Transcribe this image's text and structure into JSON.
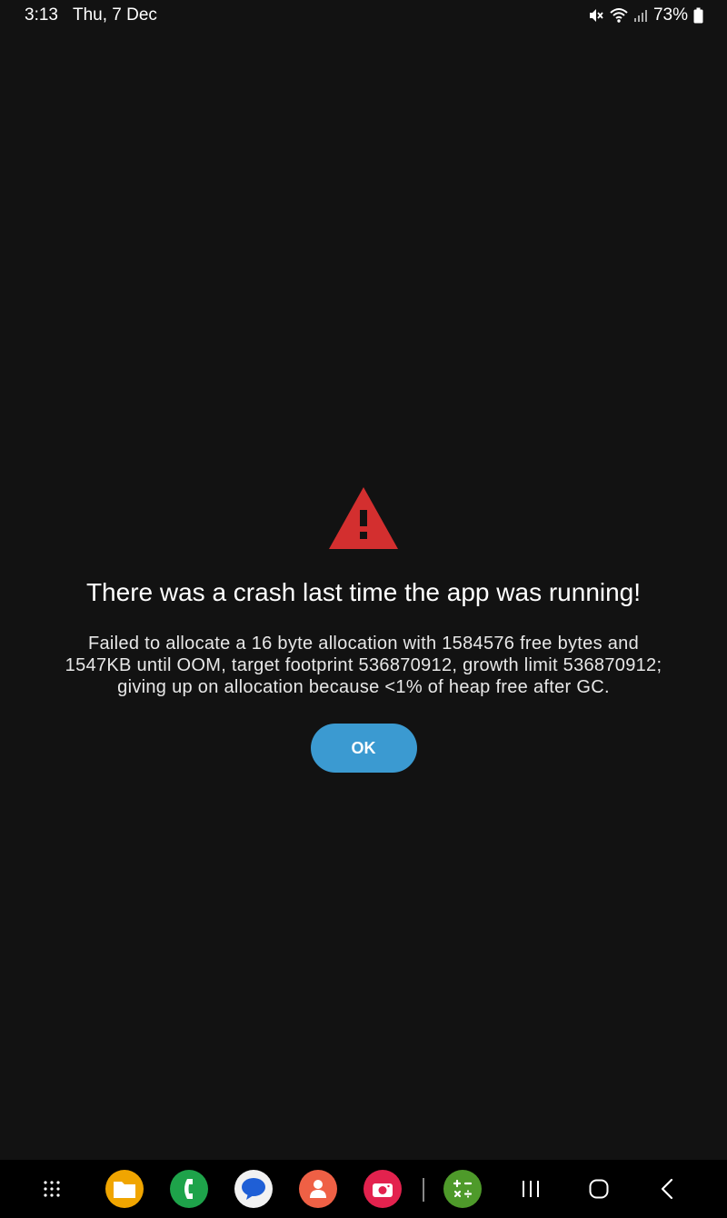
{
  "status_bar": {
    "time": "3:13",
    "date": "Thu, 7 Dec",
    "battery": "73%",
    "icons": [
      "mute-icon",
      "wifi-icon",
      "signal-icon",
      "battery-icon"
    ]
  },
  "crash_dialog": {
    "icon": "warning-icon",
    "icon_color": "#d32f2f",
    "title": "There was a crash last time the app was running!",
    "message": "Failed to allocate a 16 byte allocation with 1584576 free bytes and 1547KB until OOM, target footprint 536870912, growth limit 536870912; giving up on allocation because <1% of heap free after GC.",
    "ok_label": "OK",
    "ok_color": "#3b9ad1"
  },
  "nav_bar": {
    "apps": [
      "apps-grid-icon",
      "files-icon",
      "phone-icon",
      "messages-icon",
      "contacts-icon",
      "camera-icon",
      "calculator-icon"
    ],
    "buttons": [
      "recents-icon",
      "home-icon",
      "back-icon"
    ]
  }
}
